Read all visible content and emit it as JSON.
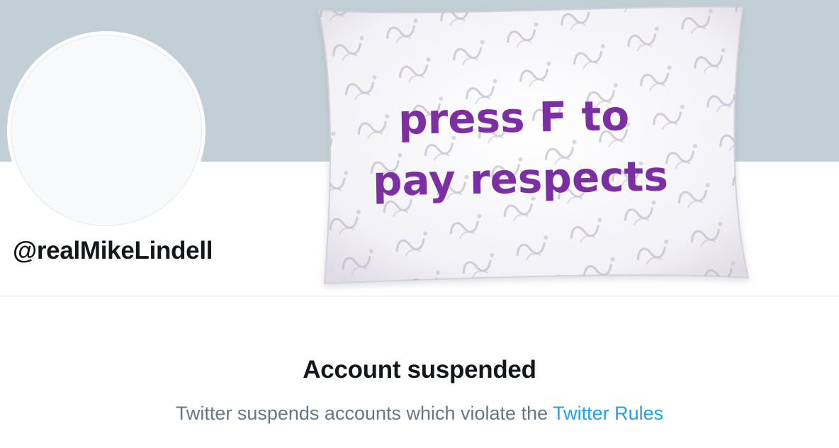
{
  "profile": {
    "handle": "@realMikeLindell"
  },
  "banner": {
    "caption_line1": "press F to",
    "caption_line2": "pay respects"
  },
  "notice": {
    "title": "Account suspended",
    "message": "Twitter suspends accounts which violate the",
    "link_label": "Twitter Rules"
  },
  "colors": {
    "banner_background": "#c3cfd6",
    "caption_text": "#7b2fa3",
    "link": "#1da1f2",
    "secondary_text": "#657786"
  }
}
